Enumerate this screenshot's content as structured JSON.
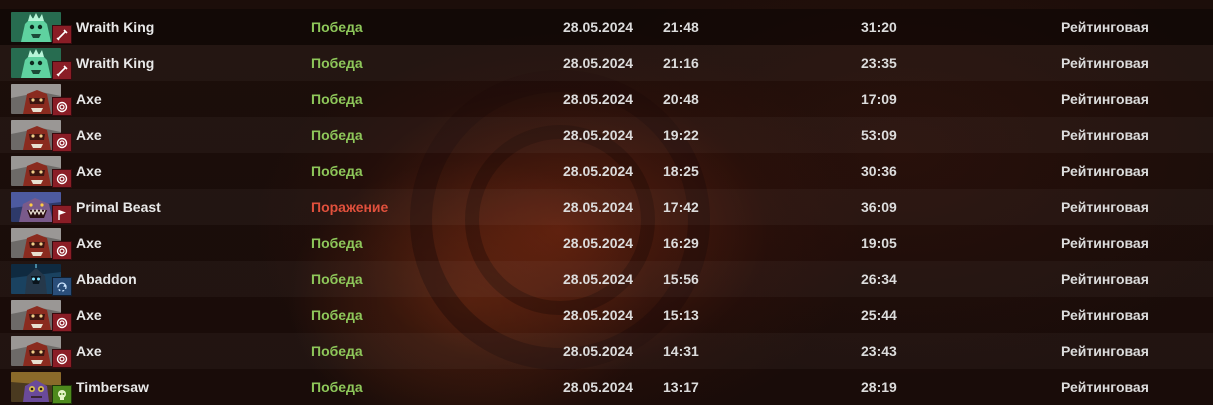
{
  "colors": {
    "win": "#8ec75a",
    "loss": "#e0503c",
    "text": "#dcdcdc"
  },
  "matches": [
    {
      "hero": "Wraith King",
      "hero_icon": "wraith-king-portrait-icon",
      "role_icon": "sword-icon",
      "result": "Победа",
      "outcome": "win",
      "date": "28.05.2024",
      "time": "21:48",
      "duration": "31:20",
      "mode": "Рейтинговая"
    },
    {
      "hero": "Wraith King",
      "hero_icon": "wraith-king-portrait-icon",
      "role_icon": "sword-icon",
      "result": "Победа",
      "outcome": "win",
      "date": "28.05.2024",
      "time": "21:16",
      "duration": "23:35",
      "mode": "Рейтинговая"
    },
    {
      "hero": "Axe",
      "hero_icon": "axe-portrait-icon",
      "role_icon": "spiral-icon",
      "result": "Победа",
      "outcome": "win",
      "date": "28.05.2024",
      "time": "20:48",
      "duration": "17:09",
      "mode": "Рейтинговая"
    },
    {
      "hero": "Axe",
      "hero_icon": "axe-portrait-icon",
      "role_icon": "spiral-icon",
      "result": "Победа",
      "outcome": "win",
      "date": "28.05.2024",
      "time": "19:22",
      "duration": "53:09",
      "mode": "Рейтинговая"
    },
    {
      "hero": "Axe",
      "hero_icon": "axe-portrait-icon",
      "role_icon": "spiral-icon",
      "result": "Победа",
      "outcome": "win",
      "date": "28.05.2024",
      "time": "18:25",
      "duration": "30:36",
      "mode": "Рейтинговая"
    },
    {
      "hero": "Primal Beast",
      "hero_icon": "primal-beast-portrait-icon",
      "role_icon": "flag-icon",
      "result": "Поражение",
      "outcome": "loss",
      "date": "28.05.2024",
      "time": "17:42",
      "duration": "36:09",
      "mode": "Рейтинговая"
    },
    {
      "hero": "Axe",
      "hero_icon": "axe-portrait-icon",
      "role_icon": "spiral-icon",
      "result": "Победа",
      "outcome": "win",
      "date": "28.05.2024",
      "time": "16:29",
      "duration": "19:05",
      "mode": "Рейтинговая"
    },
    {
      "hero": "Abaddon",
      "hero_icon": "abaddon-portrait-icon",
      "role_icon": "circle-arrows-icon",
      "result": "Победа",
      "outcome": "win",
      "date": "28.05.2024",
      "time": "15:56",
      "duration": "26:34",
      "mode": "Рейтинговая"
    },
    {
      "hero": "Axe",
      "hero_icon": "axe-portrait-icon",
      "role_icon": "spiral-icon",
      "result": "Победа",
      "outcome": "win",
      "date": "28.05.2024",
      "time": "15:13",
      "duration": "25:44",
      "mode": "Рейтинговая"
    },
    {
      "hero": "Axe",
      "hero_icon": "axe-portrait-icon",
      "role_icon": "spiral-icon",
      "result": "Победа",
      "outcome": "win",
      "date": "28.05.2024",
      "time": "14:31",
      "duration": "23:43",
      "mode": "Рейтинговая"
    },
    {
      "hero": "Timbersaw",
      "hero_icon": "timbersaw-portrait-icon",
      "role_icon": "skull-icon",
      "result": "Победа",
      "outcome": "win",
      "date": "28.05.2024",
      "time": "13:17",
      "duration": "28:19",
      "mode": "Рейтинговая"
    }
  ]
}
